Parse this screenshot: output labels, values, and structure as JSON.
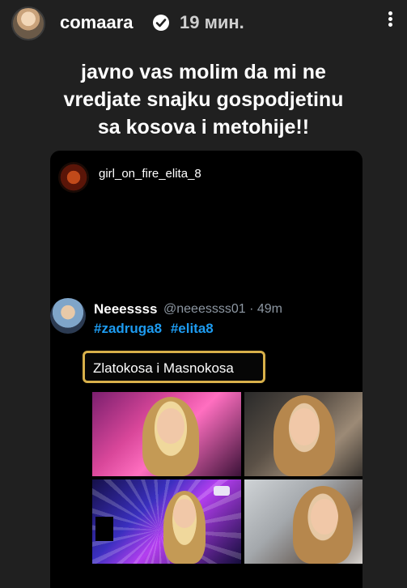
{
  "header": {
    "username": "comaara",
    "time": "19 мин."
  },
  "caption": {
    "line1": "javno vas molim da mi ne",
    "line2": "vredjate snajku gospodjetinu",
    "line3": "sa kosova i metohije!!"
  },
  "card": {
    "username": "girl_on_fire_elita_8",
    "tweet": {
      "name": "Neeessss",
      "handle": "@neeessss01 · 49m",
      "tags": [
        "#zadruga8",
        "#elita8"
      ],
      "text": "Zlatokosa i Masnokosa"
    }
  },
  "colors": {
    "background": "#202020",
    "hashtag": "#1d9bf0",
    "highlight_border": "#d8b04a"
  },
  "icons": {
    "verified": "verified-badge-icon",
    "more": "more-vertical-icon"
  }
}
